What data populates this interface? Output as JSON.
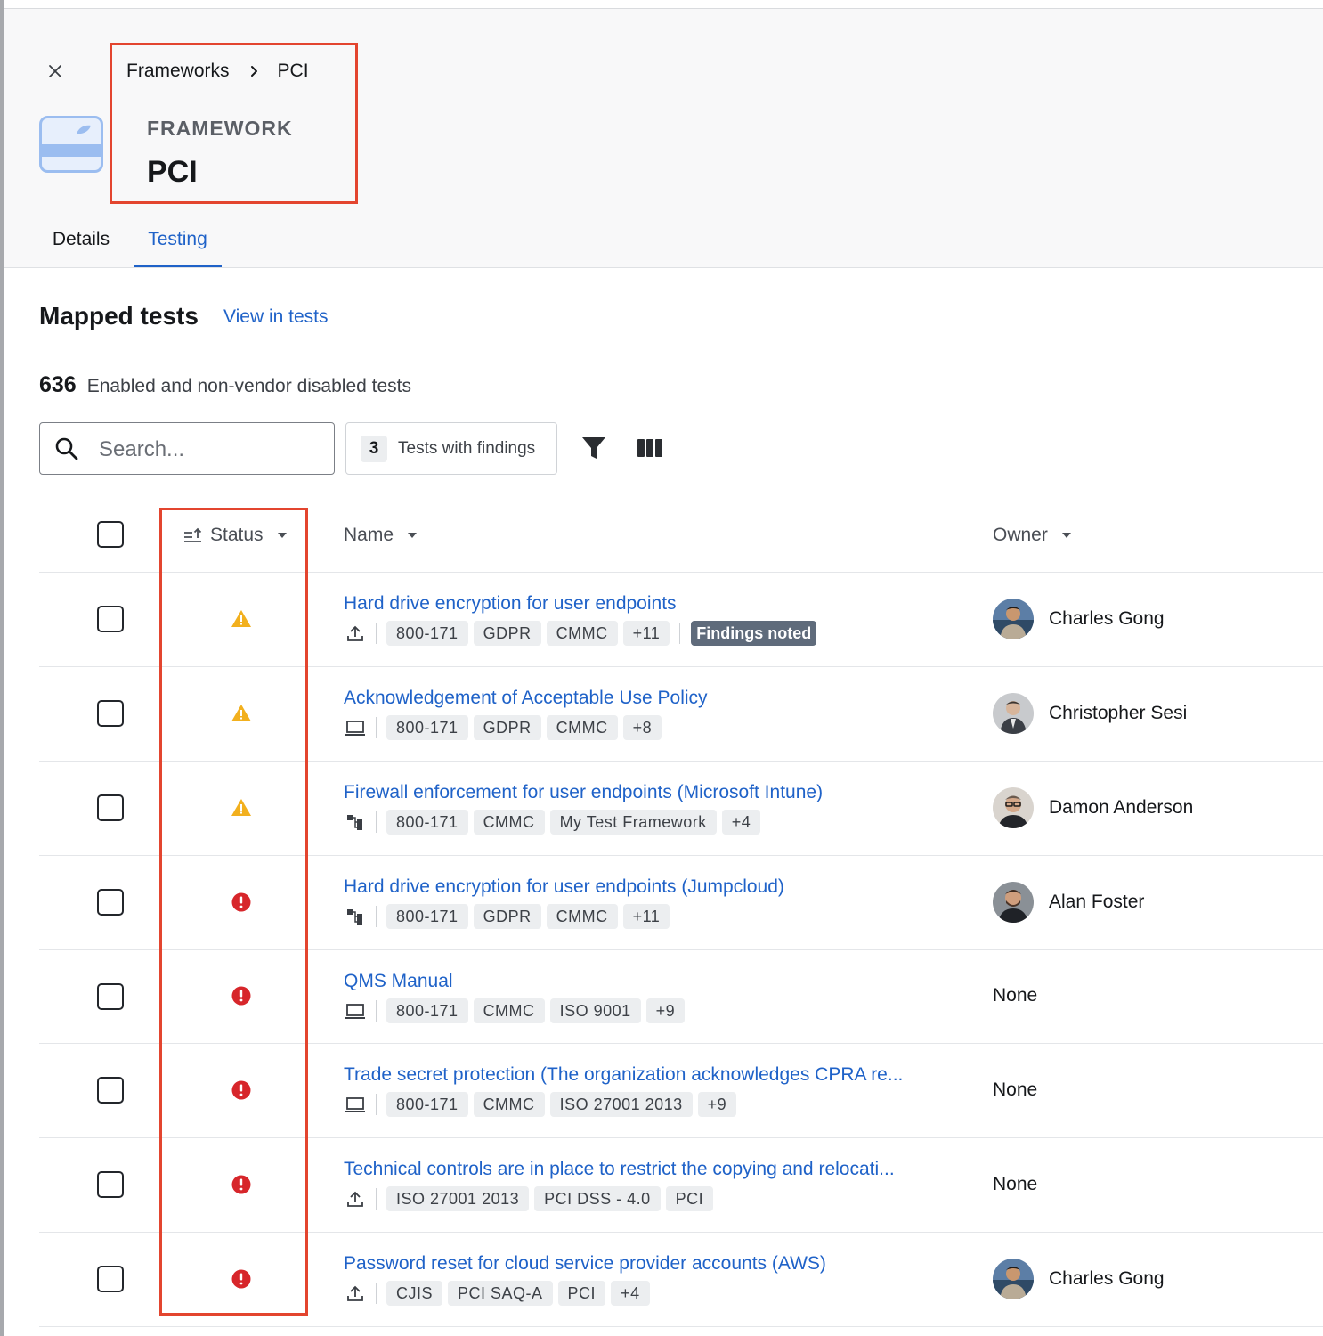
{
  "breadcrumb": {
    "root": "Frameworks",
    "current": "PCI"
  },
  "framework": {
    "kicker": "FRAMEWORK",
    "title": "PCI"
  },
  "tabs": [
    {
      "label": "Details",
      "active": false
    },
    {
      "label": "Testing",
      "active": true
    }
  ],
  "section": {
    "title": "Mapped tests",
    "view_link": "View in tests",
    "count": "636",
    "count_label": "Enabled and non-vendor disabled tests"
  },
  "toolbar": {
    "search_placeholder": "Search...",
    "findings_count": "3",
    "findings_label": "Tests with findings"
  },
  "table": {
    "columns": {
      "status": "Status",
      "name": "Name",
      "owner": "Owner"
    },
    "rows": [
      {
        "status": "warning",
        "name": "Hard drive encryption for user endpoints",
        "type": "upload",
        "tags": [
          "800-171",
          "GDPR",
          "CMMC",
          "+11"
        ],
        "badge": "Findings noted",
        "owner": "Charles Gong"
      },
      {
        "status": "warning",
        "name": "Acknowledgement of Acceptable Use Policy",
        "type": "laptop",
        "tags": [
          "800-171",
          "GDPR",
          "CMMC",
          "+8"
        ],
        "owner": "Christopher Sesi"
      },
      {
        "status": "warning",
        "name": "Firewall enforcement for user endpoints (Microsoft Intune)",
        "type": "integration",
        "tags": [
          "800-171",
          "CMMC",
          "My Test Framework",
          "+4"
        ],
        "owner": "Damon Anderson"
      },
      {
        "status": "error",
        "name": "Hard drive encryption for user endpoints (Jumpcloud)",
        "type": "integration",
        "tags": [
          "800-171",
          "GDPR",
          "CMMC",
          "+11"
        ],
        "owner": "Alan Foster"
      },
      {
        "status": "error",
        "name": "QMS Manual",
        "type": "laptop",
        "tags": [
          "800-171",
          "CMMC",
          "ISO 9001",
          "+9"
        ],
        "owner": "None"
      },
      {
        "status": "error",
        "name": "Trade secret protection (The organization acknowledges CPRA re...",
        "type": "laptop",
        "tags": [
          "800-171",
          "CMMC",
          "ISO 27001 2013",
          "+9"
        ],
        "owner": "None"
      },
      {
        "status": "error",
        "name": "Technical controls are in place to restrict the copying and relocati...",
        "type": "upload",
        "tags": [
          "ISO 27001 2013",
          "PCI DSS - 4.0",
          "PCI"
        ],
        "owner": "None"
      },
      {
        "status": "error",
        "name": "Password reset for cloud service provider accounts (AWS)",
        "type": "upload",
        "tags": [
          "CJIS",
          "PCI SAQ-A",
          "PCI",
          "+4"
        ],
        "owner": "Charles Gong"
      }
    ]
  },
  "colors": {
    "accent": "#1f62c8",
    "warning": "#f2b01e",
    "error": "#d7262b",
    "highlight": "#e3452f",
    "badge": "#5f6b7b"
  },
  "icons": {
    "close": "close-icon",
    "chevron": "chevron-right-icon",
    "framework": "credit-card-icon",
    "search": "search-icon",
    "filter": "filter-icon",
    "columns": "columns-icon",
    "sort": "sort-ascending-icon",
    "caret": "caret-down-icon",
    "warning": "warning-triangle-icon",
    "error": "error-circle-icon",
    "upload": "upload-icon",
    "laptop": "laptop-icon",
    "integration": "integration-icon"
  }
}
